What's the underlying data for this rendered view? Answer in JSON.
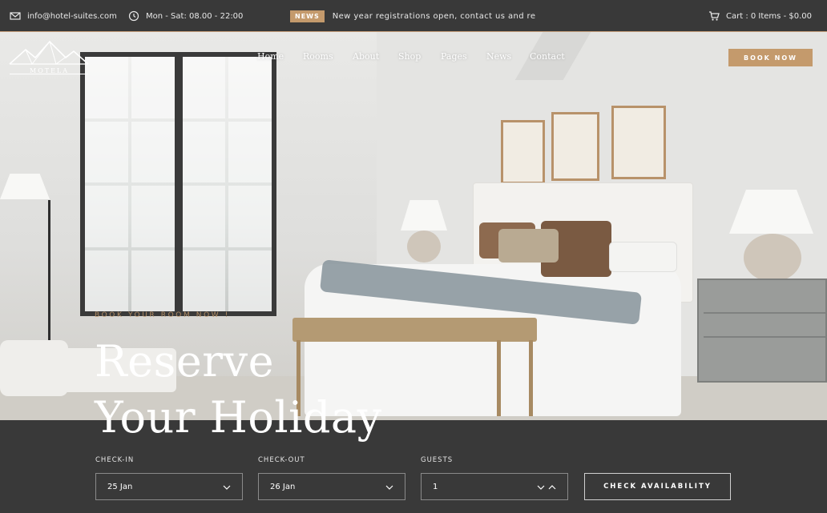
{
  "topbar": {
    "email": "info@hotel-suites.com",
    "hours": "Mon - Sat: 08.00 - 22:00",
    "news_badge": "NEWS",
    "news_text": "New year registrations open, contact us and renew y",
    "cart": "Cart : 0 Items - $0.00"
  },
  "header": {
    "logo_text": "MOTELA",
    "nav": [
      "Home",
      "Rooms",
      "About",
      "Shop",
      "Pages",
      "News",
      "Contact"
    ],
    "book_button": "BOOK NOW"
  },
  "hero": {
    "tagline": "BOOK YOUR ROOM NOW !",
    "title_line1": "Reserve",
    "title_line2": "Your Holiday"
  },
  "booking": {
    "checkin_label": "CHECK-IN",
    "checkin_value": "25 Jan",
    "checkout_label": "CHECK-OUT",
    "checkout_value": "26 Jan",
    "guests_label": "GUESTS",
    "guests_value": "1",
    "submit_label": "CHECK AVAILABILITY"
  },
  "colors": {
    "accent": "#c49a6c",
    "dark_bar": "#393939"
  },
  "icons": [
    "envelope-icon",
    "clock-icon",
    "cart-icon",
    "mountain-logo-icon",
    "chevron-down-icon"
  ]
}
